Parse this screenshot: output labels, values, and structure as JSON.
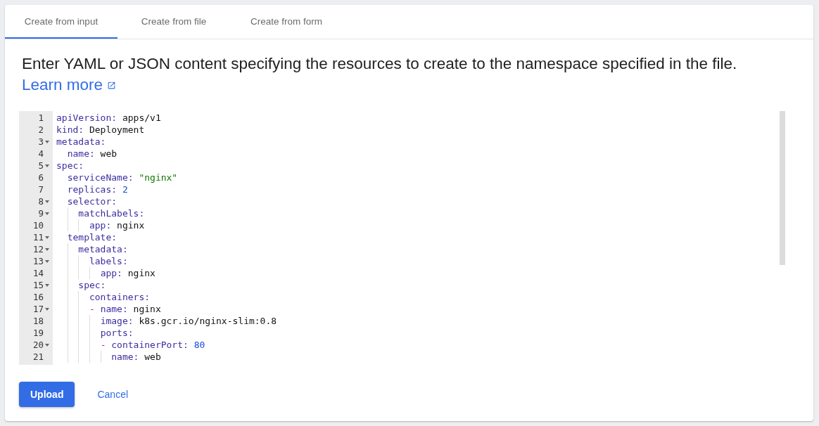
{
  "tabs": [
    {
      "label": "Create from input",
      "selected": true
    },
    {
      "label": "Create from file",
      "selected": false
    },
    {
      "label": "Create from form",
      "selected": false
    }
  ],
  "description": "Enter YAML or JSON content specifying the resources to create to the namespace specified in the file.",
  "learn_more": "Learn more",
  "editor": {
    "lines": [
      {
        "number": "1",
        "text": "apiVersion: apps/v1",
        "foldable": false,
        "kind": "plain"
      },
      {
        "number": "2",
        "text": "kind: Deployment",
        "foldable": false,
        "kind": "plain"
      },
      {
        "number": "3",
        "text": "metadata:",
        "foldable": true,
        "kind": "plain"
      },
      {
        "number": "4",
        "text": "  name: web",
        "foldable": false,
        "kind": "plain"
      },
      {
        "number": "5",
        "text": "spec:",
        "foldable": true,
        "kind": "plain"
      },
      {
        "number": "6",
        "text": "  serviceName: \"nginx\"",
        "foldable": false,
        "kind": "string"
      },
      {
        "number": "7",
        "text": "  replicas: 2",
        "foldable": false,
        "kind": "number"
      },
      {
        "number": "8",
        "text": "  selector:",
        "foldable": true,
        "kind": "plain"
      },
      {
        "number": "9",
        "text": "    matchLabels:",
        "foldable": true,
        "kind": "plain"
      },
      {
        "number": "10",
        "text": "      app: nginx",
        "foldable": false,
        "kind": "plain"
      },
      {
        "number": "11",
        "text": "  template:",
        "foldable": true,
        "kind": "plain"
      },
      {
        "number": "12",
        "text": "    metadata:",
        "foldable": true,
        "kind": "plain"
      },
      {
        "number": "13",
        "text": "      labels:",
        "foldable": true,
        "kind": "plain"
      },
      {
        "number": "14",
        "text": "        app: nginx",
        "foldable": false,
        "kind": "plain"
      },
      {
        "number": "15",
        "text": "    spec:",
        "foldable": true,
        "kind": "plain"
      },
      {
        "number": "16",
        "text": "      containers:",
        "foldable": false,
        "kind": "plain"
      },
      {
        "number": "17",
        "text": "      - name: nginx",
        "foldable": true,
        "kind": "plain"
      },
      {
        "number": "18",
        "text": "        image: k8s.gcr.io/nginx-slim:0.8",
        "foldable": false,
        "kind": "plain"
      },
      {
        "number": "19",
        "text": "        ports:",
        "foldable": false,
        "kind": "plain"
      },
      {
        "number": "20",
        "text": "        - containerPort: 80",
        "foldable": true,
        "kind": "number"
      },
      {
        "number": "21",
        "text": "          name: web",
        "foldable": false,
        "kind": "plain"
      }
    ]
  },
  "buttons": [
    {
      "label": "Upload",
      "kind": "primary"
    },
    {
      "label": "Cancel",
      "kind": "text"
    }
  ]
}
